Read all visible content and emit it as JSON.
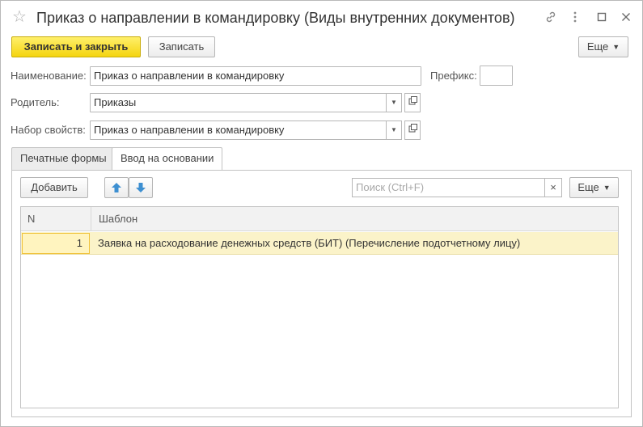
{
  "window": {
    "title": "Приказ о направлении в командировку (Виды внутренних документов)",
    "star_icon": "star-icon",
    "link_icon": "link-icon",
    "menu_icon": "more-vertical-icon",
    "maximize_icon": "maximize-icon",
    "close_icon": "close-icon"
  },
  "toolbar": {
    "save_close_label": "Записать и закрыть",
    "save_label": "Записать",
    "more_label": "Еще"
  },
  "form": {
    "name_label": "Наименование:",
    "name_value": "Приказ о направлении в командировку",
    "prefix_label": "Префикс:",
    "prefix_value": "",
    "parent_label": "Родитель:",
    "parent_value": "Приказы",
    "props_label": "Набор свойств:",
    "props_value": "Приказ о направлении в командировку"
  },
  "tabs": [
    {
      "label": "Печатные формы",
      "active": false
    },
    {
      "label": "Ввод на основании",
      "active": true
    }
  ],
  "panel": {
    "add_label": "Добавить",
    "up_icon": "arrow-up-icon",
    "down_icon": "arrow-down-icon",
    "search_placeholder": "Поиск (Ctrl+F)",
    "clear_icon": "×",
    "more_label": "Еще"
  },
  "table": {
    "columns": [
      "N",
      "Шаблон"
    ],
    "rows": [
      {
        "n": "1",
        "template": "Заявка на расходование денежных средств (БИТ) (Перечисление подотчетному лицу)"
      }
    ]
  },
  "colors": {
    "primary_button": "#f4d410",
    "selected_row": "#fbf3c9",
    "selected_cell_border": "#f0c23a",
    "arrow_blue": "#3d8fd1"
  }
}
